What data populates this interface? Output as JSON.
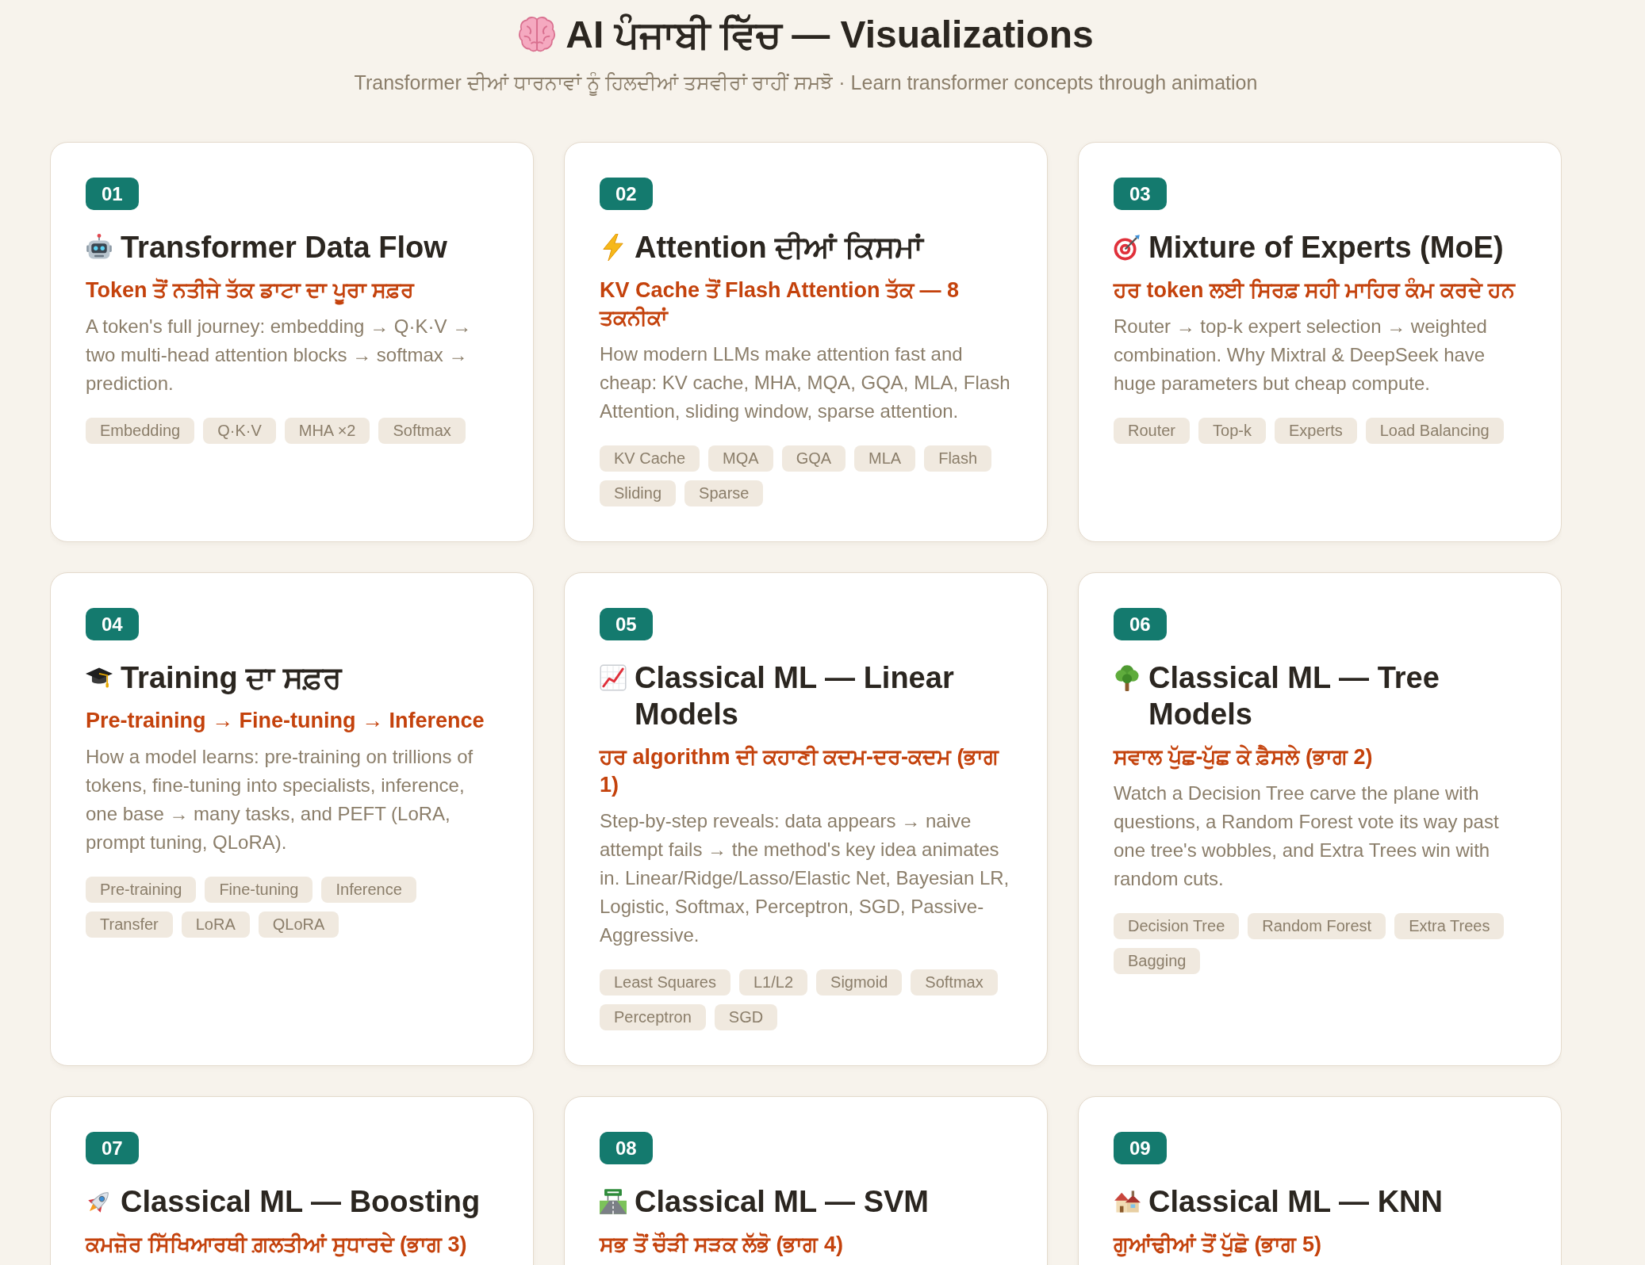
{
  "header": {
    "title": "AI ਪੰਜਾਬੀ ਵਿੱਚ — Visualizations",
    "subtitle": "Transformer ਦੀਆਂ ਧਾਰਨਾਵਾਂ ਨੂੰ ਹਿਲਦੀਆਂ ਤਸਵੀਰਾਂ ਰਾਹੀਂ ਸਮਝੋ · Learn transformer concepts through animation"
  },
  "cards": [
    {
      "number": "01",
      "title": "Transformer Data Flow",
      "subtitle": "Token ਤੋਂ ਨਤੀਜੇ ਤੱਕ ਡਾਟਾ ਦਾ ਪੂਰਾ ਸਫ਼ਰ",
      "description": "A token's full journey: embedding → Q·K·V → two multi-head attention blocks → softmax → prediction.",
      "tags": [
        "Embedding",
        "Q·K·V",
        "MHA ×2",
        "Softmax"
      ]
    },
    {
      "number": "02",
      "title": "Attention ਦੀਆਂ ਕਿਸਮਾਂ",
      "subtitle": "KV Cache ਤੋਂ Flash Attention ਤੱਕ — 8 ਤਕਨੀਕਾਂ",
      "description": "How modern LLMs make attention fast and cheap: KV cache, MHA, MQA, GQA, MLA, Flash Attention, sliding window, sparse attention.",
      "tags": [
        "KV Cache",
        "MQA",
        "GQA",
        "MLA",
        "Flash",
        "Sliding",
        "Sparse"
      ]
    },
    {
      "number": "03",
      "title": "Mixture of Experts (MoE)",
      "subtitle": "ਹਰ token ਲਈ ਸਿਰਫ਼ ਸਹੀ ਮਾਹਿਰ ਕੰਮ ਕਰਦੇ ਹਨ",
      "description": "Router → top-k expert selection → weighted combination. Why Mixtral & DeepSeek have huge parameters but cheap compute.",
      "tags": [
        "Router",
        "Top-k",
        "Experts",
        "Load Balancing"
      ]
    },
    {
      "number": "04",
      "title": "Training ਦਾ ਸਫ਼ਰ",
      "subtitle": "Pre-training → Fine-tuning → Inference",
      "description": "How a model learns: pre-training on trillions of tokens, fine-tuning into specialists, inference, one base → many tasks, and PEFT (LoRA, prompt tuning, QLoRA).",
      "tags": [
        "Pre-training",
        "Fine-tuning",
        "Inference",
        "Transfer",
        "LoRA",
        "QLoRA"
      ]
    },
    {
      "number": "05",
      "title": "Classical ML — Linear Models",
      "subtitle": "ਹਰ algorithm ਦੀ ਕਹਾਣੀ ਕਦਮ-ਦਰ-ਕਦਮ (ਭਾਗ 1)",
      "description": "Step-by-step reveals: data appears → naive attempt fails → the method's key idea animates in. Linear/Ridge/Lasso/Elastic Net, Bayesian LR, Logistic, Softmax, Perceptron, SGD, Passive-Aggressive.",
      "tags": [
        "Least Squares",
        "L1/L2",
        "Sigmoid",
        "Softmax",
        "Perceptron",
        "SGD"
      ]
    },
    {
      "number": "06",
      "title": "Classical ML — Tree Models",
      "subtitle": "ਸਵਾਲ ਪੁੱਛ-ਪੁੱਛ ਕੇ ਫ਼ੈਸਲੇ (ਭਾਗ 2)",
      "description": "Watch a Decision Tree carve the plane with questions, a Random Forest vote its way past one tree's wobbles, and Extra Trees win with random cuts.",
      "tags": [
        "Decision Tree",
        "Random Forest",
        "Extra Trees",
        "Bagging"
      ]
    },
    {
      "number": "07",
      "title": "Classical ML — Boosting",
      "subtitle": "ਕਮਜ਼ੋਰ ਸਿੱਖਿਆਰਥੀ ਗ਼ਲਤੀਆਂ ਸੁਧਾਰਦੇ (ਭਾਗ 3)"
    },
    {
      "number": "08",
      "title": "Classical ML — SVM",
      "subtitle": "ਸਭ ਤੋਂ ਚੌੜੀ ਸੜਕ ਲੱਭੋ (ਭਾਗ 4)"
    },
    {
      "number": "09",
      "title": "Classical ML — KNN",
      "subtitle": "ਗੁਆਂਢੀਆਂ ਤੋਂ ਪੁੱਛੋ (ਭਾਗ 5)"
    }
  ]
}
